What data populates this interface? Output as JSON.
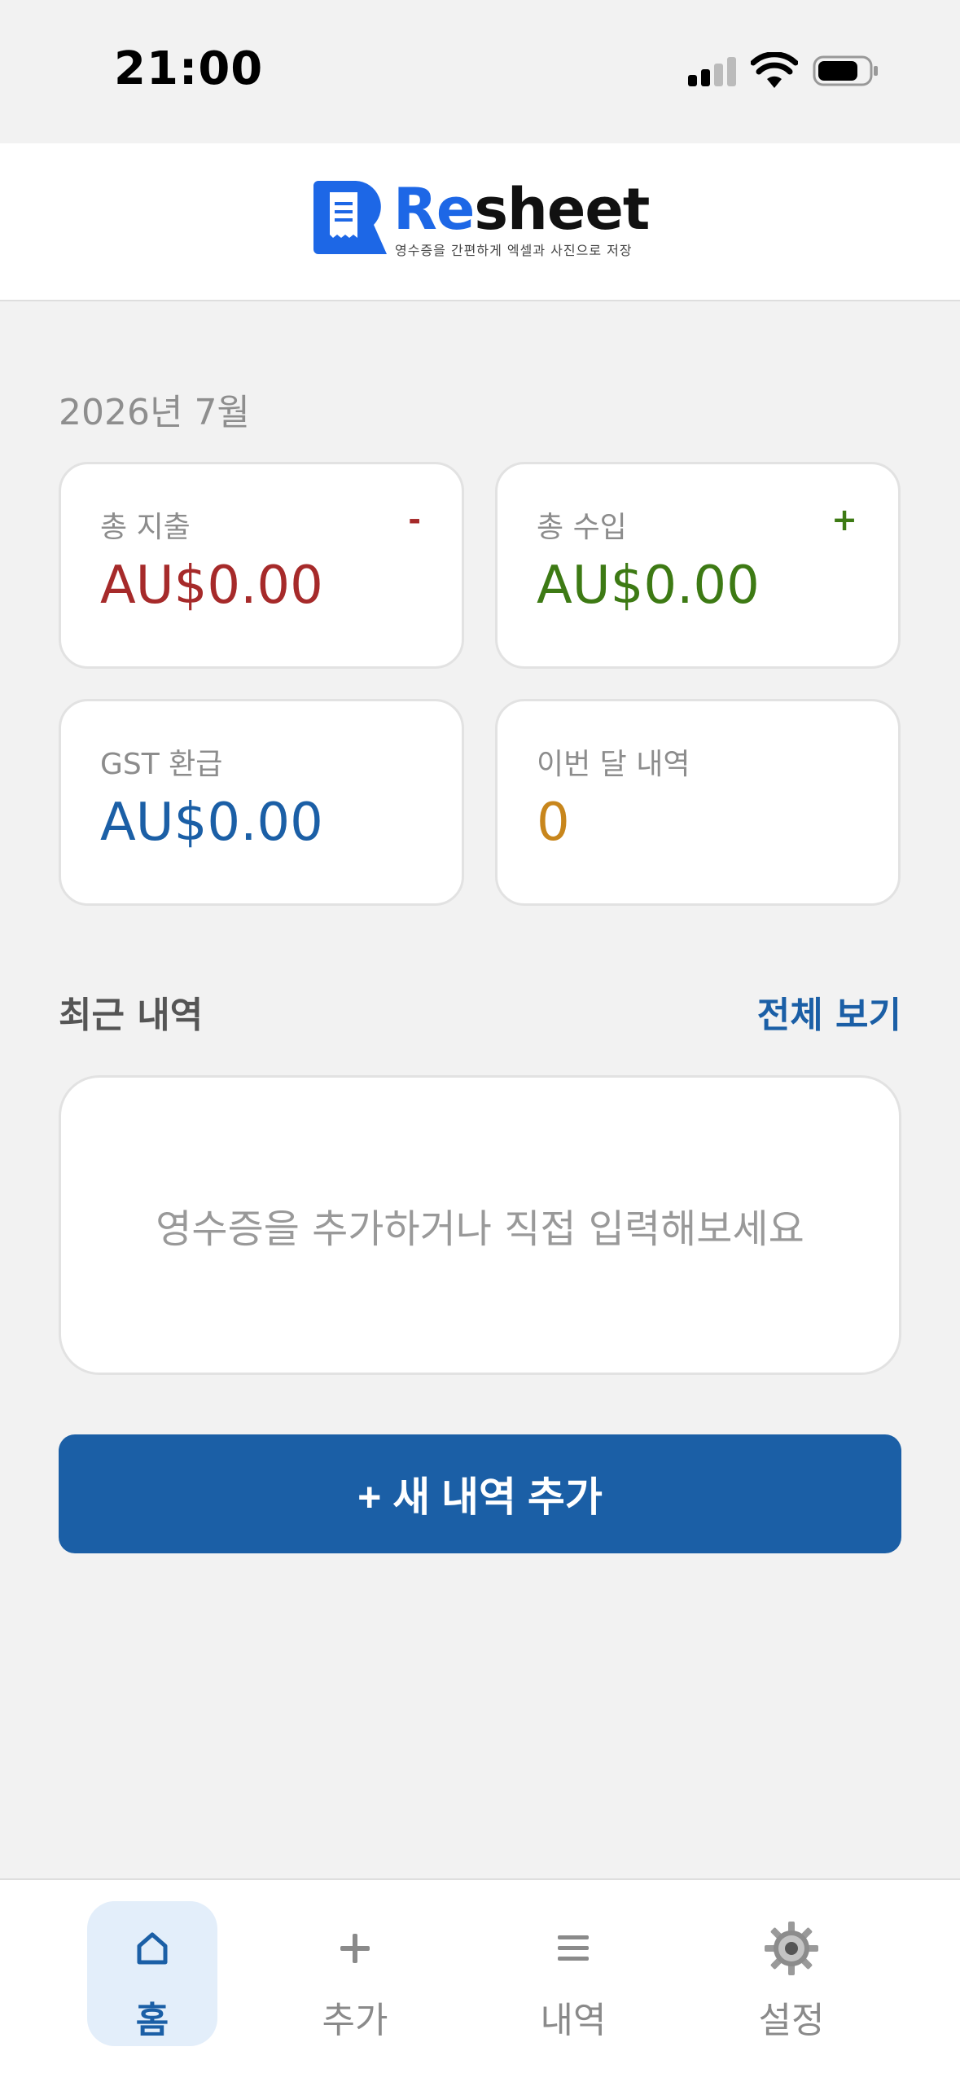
{
  "status_bar": {
    "time": "21:00"
  },
  "header": {
    "logo_prefix": "Re",
    "logo_suffix": "sheet",
    "tagline": "영수증을 간편하게 엑셀과 사진으로 저장"
  },
  "month": "2026년 7월",
  "cards": {
    "expense": {
      "label": "총 지출",
      "sign": "-",
      "value": "AU$0.00"
    },
    "income": {
      "label": "총 수입",
      "sign": "+",
      "value": "AU$0.00"
    },
    "gst": {
      "label": "GST 환급",
      "value": "AU$0.00"
    },
    "count": {
      "label": "이번 달 내역",
      "value": "0"
    }
  },
  "recent": {
    "title": "최근 내역",
    "view_all": "전체 보기",
    "empty_message": "영수증을 추가하거나 직접 입력해보세요"
  },
  "add_button": "+ 새 내역 추가",
  "tabs": [
    {
      "label": "홈",
      "icon": "home-icon",
      "active": true
    },
    {
      "label": "추가",
      "icon": "plus-icon",
      "active": false
    },
    {
      "label": "내역",
      "icon": "list-icon",
      "active": false
    },
    {
      "label": "설정",
      "icon": "gear-icon",
      "active": false
    }
  ],
  "colors": {
    "accent": "#1b5fa6",
    "expense": "#a62a2a",
    "income": "#3d7a14",
    "gst": "#1b5fa6",
    "count": "#c8861c"
  }
}
